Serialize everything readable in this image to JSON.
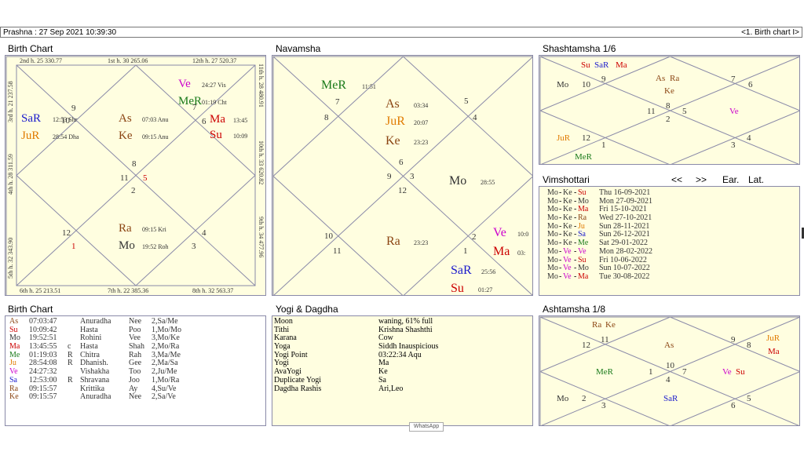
{
  "header": {
    "left": "Prashna :   27 Sep 2021  10:39:30",
    "right": "<1. Birth chart I>"
  },
  "colors": {
    "panel_bg": "#fffee0",
    "line": "#8a8aa8",
    "red": "#cc0000",
    "blue": "#1a1acc",
    "green": "#1a7a1a",
    "brown": "#8b4513",
    "orange": "#e07b00",
    "magenta": "#cc00cc",
    "dark": "#333333"
  },
  "titles": {
    "birth_chart": "Birth Chart",
    "navamsha": "Navamsha",
    "shashtamsha": "Shashtamsha 1/6",
    "vimshottari": "Vimshottari",
    "birth_table": "Birth Chart",
    "yogi": "Yogi & Dagdha",
    "ashtamsha": "Ashtamsha 1/8"
  },
  "nav": {
    "prev": "<<",
    "next": ">>",
    "ear": "Ear.",
    "lat": "Lat."
  },
  "birth_chart": {
    "house_labels": {
      "top": [
        "2nd h.  25  330.77",
        "1st h.  30  265.06",
        "12th h.  27  520.37"
      ],
      "bottom": [
        "6th h.  25  213.51",
        "7th h.  22  385.36",
        "8th h.  32  563.37"
      ],
      "left": [
        "3rd h.  21  237.58",
        "4th h.  28  311.59",
        "5th h.  32  343.90"
      ],
      "right": [
        "11th h.  28  480.91",
        "10th h.  33  620.82",
        "9th h.  34  477.96"
      ]
    },
    "texts": [
      {
        "t": "Ve",
        "c": "magenta",
        "s": 15
      },
      {
        "t": "24:27  Vis",
        "c": "dark",
        "s": 8
      },
      {
        "t": "MeR",
        "c": "green",
        "s": 15
      },
      {
        "t": "01:19  Cht",
        "c": "dark",
        "s": 8
      },
      {
        "t": "Ma",
        "c": "red",
        "s": 15
      },
      {
        "t": "13:45",
        "c": "dark",
        "s": 8
      },
      {
        "t": "Su",
        "c": "red",
        "s": 15
      },
      {
        "t": "10:09",
        "c": "dark",
        "s": 8
      },
      {
        "t": "SaR",
        "c": "blue",
        "s": 15
      },
      {
        "t": "12:53  Shr",
        "c": "dark",
        "s": 8
      },
      {
        "t": "JuR",
        "c": "orange",
        "s": 15
      },
      {
        "t": "28:54  Dha",
        "c": "dark",
        "s": 8
      },
      {
        "t": "As",
        "c": "brown",
        "s": 15
      },
      {
        "t": "07:03  Anu",
        "c": "dark",
        "s": 8
      },
      {
        "t": "Ke",
        "c": "brown",
        "s": 15
      },
      {
        "t": "09:15  Anu",
        "c": "dark",
        "s": 8
      },
      {
        "t": "Ra",
        "c": "brown",
        "s": 15
      },
      {
        "t": "09:15  Kri",
        "c": "dark",
        "s": 8
      },
      {
        "t": "Mo",
        "c": "dark",
        "s": 15
      },
      {
        "t": "19:52  Roh",
        "c": "dark",
        "s": 8
      },
      {
        "t": "9",
        "c": "dark",
        "s": 11
      },
      {
        "t": "10",
        "c": "dark",
        "s": 11
      },
      {
        "t": "7",
        "c": "dark",
        "s": 11
      },
      {
        "t": "6",
        "c": "dark",
        "s": 11
      },
      {
        "t": "8",
        "c": "dark",
        "s": 11
      },
      {
        "t": "11",
        "c": "dark",
        "s": 11
      },
      {
        "t": "5",
        "c": "red",
        "s": 11
      },
      {
        "t": "2",
        "c": "dark",
        "s": 11
      },
      {
        "t": "12",
        "c": "dark",
        "s": 11
      },
      {
        "t": "1",
        "c": "red",
        "s": 11
      },
      {
        "t": "4",
        "c": "dark",
        "s": 11
      },
      {
        "t": "3",
        "c": "dark",
        "s": 11
      }
    ]
  },
  "navamsha": {
    "texts": [
      {
        "t": "MeR",
        "c": "green",
        "s": 16
      },
      {
        "t": "11:51",
        "c": "dark",
        "s": 8
      },
      {
        "t": "As",
        "c": "brown",
        "s": 16
      },
      {
        "t": "03:34",
        "c": "dark",
        "s": 8
      },
      {
        "t": "JuR",
        "c": "orange",
        "s": 16
      },
      {
        "t": "20:07",
        "c": "dark",
        "s": 8
      },
      {
        "t": "Ke",
        "c": "brown",
        "s": 16
      },
      {
        "t": "23:23",
        "c": "dark",
        "s": 8
      },
      {
        "t": "Mo",
        "c": "dark",
        "s": 16
      },
      {
        "t": "28:55",
        "c": "dark",
        "s": 8
      },
      {
        "t": "Ra",
        "c": "brown",
        "s": 16
      },
      {
        "t": "23:23",
        "c": "dark",
        "s": 8
      },
      {
        "t": "Ve",
        "c": "magenta",
        "s": 16
      },
      {
        "t": "10:0",
        "c": "dark",
        "s": 8
      },
      {
        "t": "Ma",
        "c": "red",
        "s": 16
      },
      {
        "t": "03:",
        "c": "dark",
        "s": 8
      },
      {
        "t": "SaR",
        "c": "blue",
        "s": 16
      },
      {
        "t": "25:56",
        "c": "dark",
        "s": 8
      },
      {
        "t": "Su",
        "c": "red",
        "s": 16
      },
      {
        "t": "01:27",
        "c": "dark",
        "s": 8
      },
      {
        "t": "7",
        "c": "dark",
        "s": 11
      },
      {
        "t": "8",
        "c": "dark",
        "s": 11
      },
      {
        "t": "5",
        "c": "dark",
        "s": 11
      },
      {
        "t": "4",
        "c": "dark",
        "s": 11
      },
      {
        "t": "6",
        "c": "dark",
        "s": 11
      },
      {
        "t": "9",
        "c": "dark",
        "s": 11
      },
      {
        "t": "3",
        "c": "dark",
        "s": 11
      },
      {
        "t": "12",
        "c": "dark",
        "s": 11
      },
      {
        "t": "10",
        "c": "dark",
        "s": 11
      },
      {
        "t": "11",
        "c": "dark",
        "s": 11
      },
      {
        "t": "2",
        "c": "dark",
        "s": 11
      },
      {
        "t": "1",
        "c": "dark",
        "s": 11
      }
    ]
  },
  "shashtamsha": {
    "texts": [
      {
        "t": "Su",
        "c": "red",
        "s": 11
      },
      {
        "t": "SaR",
        "c": "blue",
        "s": 11
      },
      {
        "t": "Ma",
        "c": "red",
        "s": 11
      },
      {
        "t": "Mo",
        "c": "dark",
        "s": 11
      },
      {
        "t": "As",
        "c": "brown",
        "s": 11
      },
      {
        "t": "Ra",
        "c": "brown",
        "s": 11
      },
      {
        "t": "Ke",
        "c": "brown",
        "s": 11
      },
      {
        "t": "Ve",
        "c": "magenta",
        "s": 11
      },
      {
        "t": "JuR",
        "c": "orange",
        "s": 11
      },
      {
        "t": "MeR",
        "c": "green",
        "s": 11
      },
      {
        "t": "10",
        "c": "dark",
        "s": 11
      },
      {
        "t": "9",
        "c": "dark",
        "s": 11
      },
      {
        "t": "7",
        "c": "dark",
        "s": 11
      },
      {
        "t": "6",
        "c": "dark",
        "s": 11
      },
      {
        "t": "8",
        "c": "dark",
        "s": 11
      },
      {
        "t": "11",
        "c": "dark",
        "s": 11
      },
      {
        "t": "5",
        "c": "dark",
        "s": 11
      },
      {
        "t": "2",
        "c": "dark",
        "s": 11
      },
      {
        "t": "12",
        "c": "dark",
        "s": 11
      },
      {
        "t": "1",
        "c": "dark",
        "s": 11
      },
      {
        "t": "4",
        "c": "dark",
        "s": 11
      },
      {
        "t": "3",
        "c": "dark",
        "s": 11
      }
    ]
  },
  "ashtamsha": {
    "texts": [
      {
        "t": "Ra",
        "c": "brown",
        "s": 11
      },
      {
        "t": "Ke",
        "c": "brown",
        "s": 11
      },
      {
        "t": "As",
        "c": "brown",
        "s": 11
      },
      {
        "t": "JuR",
        "c": "orange",
        "s": 11
      },
      {
        "t": "Ma",
        "c": "red",
        "s": 11
      },
      {
        "t": "MeR",
        "c": "green",
        "s": 11
      },
      {
        "t": "Ve",
        "c": "magenta",
        "s": 11
      },
      {
        "t": "Su",
        "c": "red",
        "s": 11
      },
      {
        "t": "Mo",
        "c": "dark",
        "s": 11
      },
      {
        "t": "SaR",
        "c": "blue",
        "s": 11
      },
      {
        "t": "12",
        "c": "dark",
        "s": 11
      },
      {
        "t": "11",
        "c": "dark",
        "s": 11
      },
      {
        "t": "9",
        "c": "dark",
        "s": 11
      },
      {
        "t": "8",
        "c": "dark",
        "s": 11
      },
      {
        "t": "10",
        "c": "dark",
        "s": 11
      },
      {
        "t": "1",
        "c": "dark",
        "s": 11
      },
      {
        "t": "7",
        "c": "dark",
        "s": 11
      },
      {
        "t": "4",
        "c": "dark",
        "s": 11
      },
      {
        "t": "2",
        "c": "dark",
        "s": 11
      },
      {
        "t": "3",
        "c": "dark",
        "s": 11
      },
      {
        "t": "5",
        "c": "dark",
        "s": 11
      },
      {
        "t": "6",
        "c": "dark",
        "s": 11
      }
    ]
  },
  "vimshottari": [
    {
      "a": "Mo",
      "b": "Ke",
      "c": "Su",
      "cc": "red",
      "date": "Thu  16-09-2021"
    },
    {
      "a": "Mo",
      "b": "Ke",
      "c": "Mo",
      "cc": "dark",
      "date": "Mon 27-09-2021"
    },
    {
      "a": "Mo",
      "b": "Ke",
      "c": "Ma",
      "cc": "red",
      "date": "Fri   15-10-2021"
    },
    {
      "a": "Mo",
      "b": "Ke",
      "c": "Ra",
      "cc": "brown",
      "date": "Wed 27-10-2021"
    },
    {
      "a": "Mo",
      "b": "Ke",
      "c": "Ju",
      "cc": "orange",
      "date": "Sun  28-11-2021"
    },
    {
      "a": "Mo",
      "b": "Ke",
      "c": "Sa",
      "cc": "blue",
      "date": "Sun  26-12-2021"
    },
    {
      "a": "Mo",
      "b": "Ke",
      "c": "Me",
      "cc": "green",
      "date": "Sat  29-01-2022"
    },
    {
      "a": "Mo",
      "b": "Ve",
      "c": "Ve",
      "cc": "magenta",
      "date": "Mon 28-02-2022"
    },
    {
      "a": "Mo",
      "b": "Ve",
      "c": "Su",
      "cc": "red",
      "date": "Fri   10-06-2022"
    },
    {
      "a": "Mo",
      "b": "Ve",
      "c": "Mo",
      "cc": "dark",
      "date": "Sun  10-07-2022"
    },
    {
      "a": "Mo",
      "b": "Ve",
      "c": "Ma",
      "cc": "red",
      "date": "Tue  30-08-2022"
    }
  ],
  "birth_table": [
    {
      "p": "As",
      "pc": "brown",
      "deg": "07:03:47",
      "r": "",
      "nak": "Anuradha",
      "lord": "Nee",
      "pada": "2,Sa/Me"
    },
    {
      "p": "Su",
      "pc": "red",
      "deg": "10:09:42",
      "r": "",
      "nak": "Hasta",
      "lord": "Poo",
      "pada": "1,Mo/Mo"
    },
    {
      "p": "Mo",
      "pc": "dark",
      "deg": "19:52:51",
      "r": "",
      "nak": "Rohini",
      "lord": "Vee",
      "pada": "3,Mo/Ke"
    },
    {
      "p": "Ma",
      "pc": "red",
      "deg": "13:45:55",
      "r": "c",
      "nak": "Hasta",
      "lord": "Shah",
      "pada": "2,Mo/Ra"
    },
    {
      "p": "Me",
      "pc": "green",
      "deg": "01:19:03",
      "r": "R",
      "nak": "Chitra",
      "lord": "Rah",
      "pada": "3,Ma/Me"
    },
    {
      "p": "Ju",
      "pc": "orange",
      "deg": "28:54:08",
      "r": "R",
      "nak": "Dhanish.",
      "lord": "Gee",
      "pada": "2,Ma/Sa"
    },
    {
      "p": "Ve",
      "pc": "magenta",
      "deg": "24:27:32",
      "r": "",
      "nak": "Vishakha",
      "lord": "Too",
      "pada": "2,Ju/Me"
    },
    {
      "p": "Sa",
      "pc": "blue",
      "deg": "12:53:00",
      "r": "R",
      "nak": "Shravana",
      "lord": "Joo",
      "pada": "1,Mo/Ra"
    },
    {
      "p": "Ra",
      "pc": "brown",
      "deg": "09:15:57",
      "r": "",
      "nak": "Krittika",
      "lord": "Ay",
      "pada": "4,Su/Ve"
    },
    {
      "p": "Ke",
      "pc": "brown",
      "deg": "09:15:57",
      "r": "",
      "nak": "Anuradha",
      "lord": "Nee",
      "pada": "2,Sa/Ve"
    }
  ],
  "yogi": [
    {
      "k": "Moon",
      "v": "waning, 61% full"
    },
    {
      "k": "Tithi",
      "v": "Krishna  Shashthi"
    },
    {
      "k": "Karana",
      "v": "Cow"
    },
    {
      "k": "Yoga",
      "v": "Siddh Inauspicious"
    },
    {
      "k": "Yogi Point",
      "v": "03:22:34 Aqu"
    },
    {
      "k": "Yogi",
      "v": "Ma"
    },
    {
      "k": "AvaYogi",
      "v": "Ke"
    },
    {
      "k": "Duplicate Yogi",
      "v": "Sa"
    },
    {
      "k": "Dagdha Rashis",
      "v": "Ari,Leo"
    }
  ],
  "whatsapp": "WhatsApp"
}
